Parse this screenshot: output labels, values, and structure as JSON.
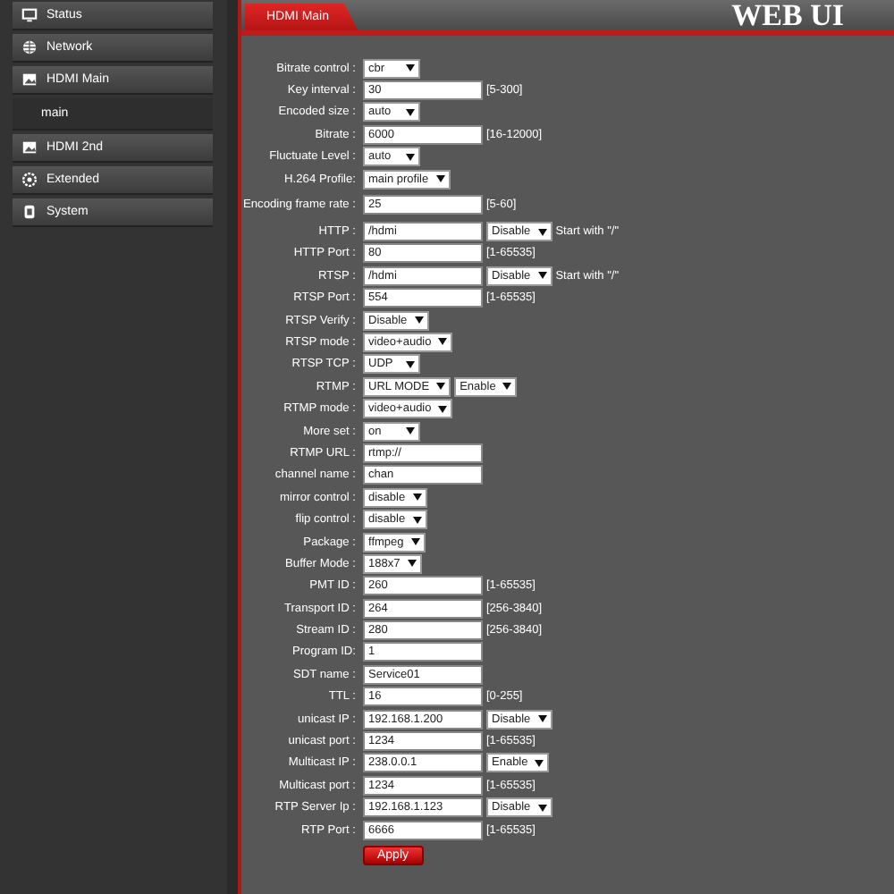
{
  "sidebar": {
    "items": [
      {
        "label": "Status",
        "selected": false
      },
      {
        "label": "Network",
        "selected": false
      },
      {
        "label": "HDMI Main",
        "selected": false,
        "children": [
          {
            "label": "main",
            "selected": true
          }
        ]
      },
      {
        "label": "HDMI 2nd",
        "selected": false
      },
      {
        "label": "Extended",
        "selected": false
      },
      {
        "label": "System",
        "selected": false
      }
    ]
  },
  "header": {
    "tab": "HDMI Main",
    "logo": "WEB UI"
  },
  "form": {
    "rows": [
      {
        "label": "Bitrate control :",
        "controls": [
          {
            "kind": "select",
            "value": "cbr"
          }
        ]
      },
      {
        "label": "Key interval :",
        "controls": [
          {
            "kind": "input",
            "value": "30"
          },
          {
            "kind": "hint",
            "value": "[5-300]"
          }
        ]
      },
      {
        "label": "Encoded size :",
        "controls": [
          {
            "kind": "select",
            "value": "auto"
          }
        ]
      },
      {
        "label": "Bitrate :",
        "controls": [
          {
            "kind": "input",
            "value": "6000"
          },
          {
            "kind": "hint",
            "value": "[16-12000]"
          }
        ]
      },
      {
        "label": "Fluctuate Level :",
        "controls": [
          {
            "kind": "select",
            "value": "auto"
          }
        ]
      },
      {
        "label": "H.264 Profile:",
        "controls": [
          {
            "kind": "select",
            "value": "main profile"
          }
        ]
      },
      {
        "label": "Encoding frame rate :",
        "controls": [
          {
            "kind": "input",
            "value": "25"
          },
          {
            "kind": "hint",
            "value": "[5-60]"
          }
        ]
      },
      {
        "label": "HTTP :",
        "controls": [
          {
            "kind": "input",
            "value": "/hdmi"
          },
          {
            "kind": "select",
            "value": "Disable"
          },
          {
            "kind": "hint",
            "value": "Start with \"/\""
          }
        ]
      },
      {
        "label": "HTTP Port :",
        "controls": [
          {
            "kind": "input",
            "value": "80"
          },
          {
            "kind": "hint",
            "value": "[1-65535]"
          }
        ]
      },
      {
        "label": "RTSP :",
        "controls": [
          {
            "kind": "input",
            "value": "/hdmi"
          },
          {
            "kind": "select",
            "value": "Disable"
          },
          {
            "kind": "hint",
            "value": "Start with \"/\""
          }
        ]
      },
      {
        "label": "RTSP Port :",
        "controls": [
          {
            "kind": "input",
            "value": "554"
          },
          {
            "kind": "hint",
            "value": "[1-65535]"
          }
        ]
      },
      {
        "label": "RTSP Verify :",
        "controls": [
          {
            "kind": "select",
            "value": "Disable"
          }
        ]
      },
      {
        "label": "RTSP mode :",
        "controls": [
          {
            "kind": "select",
            "value": "video+audio"
          }
        ]
      },
      {
        "label": "RTSP TCP :",
        "controls": [
          {
            "kind": "select",
            "value": "UDP"
          }
        ]
      },
      {
        "label": "RTMP :",
        "controls": [
          {
            "kind": "select",
            "value": "URL MODE"
          },
          {
            "kind": "select",
            "value": "Enable"
          }
        ]
      },
      {
        "label": "RTMP mode :",
        "controls": [
          {
            "kind": "select",
            "value": "video+audio"
          }
        ]
      },
      {
        "label": "More set :",
        "controls": [
          {
            "kind": "select",
            "value": "on"
          }
        ]
      },
      {
        "label": "RTMP URL :",
        "controls": [
          {
            "kind": "input",
            "value": "rtmp://"
          }
        ]
      },
      {
        "label": "channel name :",
        "controls": [
          {
            "kind": "input",
            "value": "chan"
          }
        ]
      },
      {
        "label": "mirror control :",
        "controls": [
          {
            "kind": "select",
            "value": "disable"
          }
        ]
      },
      {
        "label": "flip control :",
        "controls": [
          {
            "kind": "select",
            "value": "disable"
          }
        ]
      },
      {
        "label": "Package :",
        "controls": [
          {
            "kind": "select",
            "value": "ffmpeg"
          }
        ]
      },
      {
        "label": "Buffer Mode :",
        "controls": [
          {
            "kind": "select",
            "value": "188x7"
          }
        ]
      },
      {
        "label": "PMT ID :",
        "controls": [
          {
            "kind": "input",
            "value": "260"
          },
          {
            "kind": "hint",
            "value": "[1-65535]"
          }
        ]
      },
      {
        "label": "Transport ID :",
        "controls": [
          {
            "kind": "input",
            "value": "264"
          },
          {
            "kind": "hint",
            "value": "[256-3840]"
          }
        ]
      },
      {
        "label": "Stream ID :",
        "controls": [
          {
            "kind": "input",
            "value": "280"
          },
          {
            "kind": "hint",
            "value": "[256-3840]"
          }
        ]
      },
      {
        "label": "Program ID:",
        "controls": [
          {
            "kind": "input",
            "value": "1"
          }
        ]
      },
      {
        "label": "SDT name :",
        "controls": [
          {
            "kind": "input",
            "value": "Service01"
          }
        ]
      },
      {
        "label": "TTL :",
        "controls": [
          {
            "kind": "input",
            "value": "16"
          },
          {
            "kind": "hint",
            "value": "[0-255]"
          }
        ]
      },
      {
        "label": "unicast IP :",
        "controls": [
          {
            "kind": "input",
            "value": "192.168.1.200"
          },
          {
            "kind": "select",
            "value": "Disable"
          }
        ]
      },
      {
        "label": "unicast port :",
        "controls": [
          {
            "kind": "input",
            "value": "1234"
          },
          {
            "kind": "hint",
            "value": "[1-65535]"
          }
        ]
      },
      {
        "label": "Multicast IP :",
        "controls": [
          {
            "kind": "input",
            "value": "238.0.0.1"
          },
          {
            "kind": "select",
            "value": "Enable"
          }
        ]
      },
      {
        "label": "Multicast port :",
        "controls": [
          {
            "kind": "input",
            "value": "1234"
          },
          {
            "kind": "hint",
            "value": "[1-65535]"
          }
        ]
      },
      {
        "label": "RTP Server Ip :",
        "controls": [
          {
            "kind": "input",
            "value": "192.168.1.123"
          },
          {
            "kind": "select",
            "value": "Disable"
          }
        ]
      },
      {
        "label": "RTP Port :",
        "controls": [
          {
            "kind": "input",
            "value": "6666"
          },
          {
            "kind": "hint",
            "value": "[1-65535]"
          }
        ]
      }
    ],
    "apply": "Apply"
  }
}
